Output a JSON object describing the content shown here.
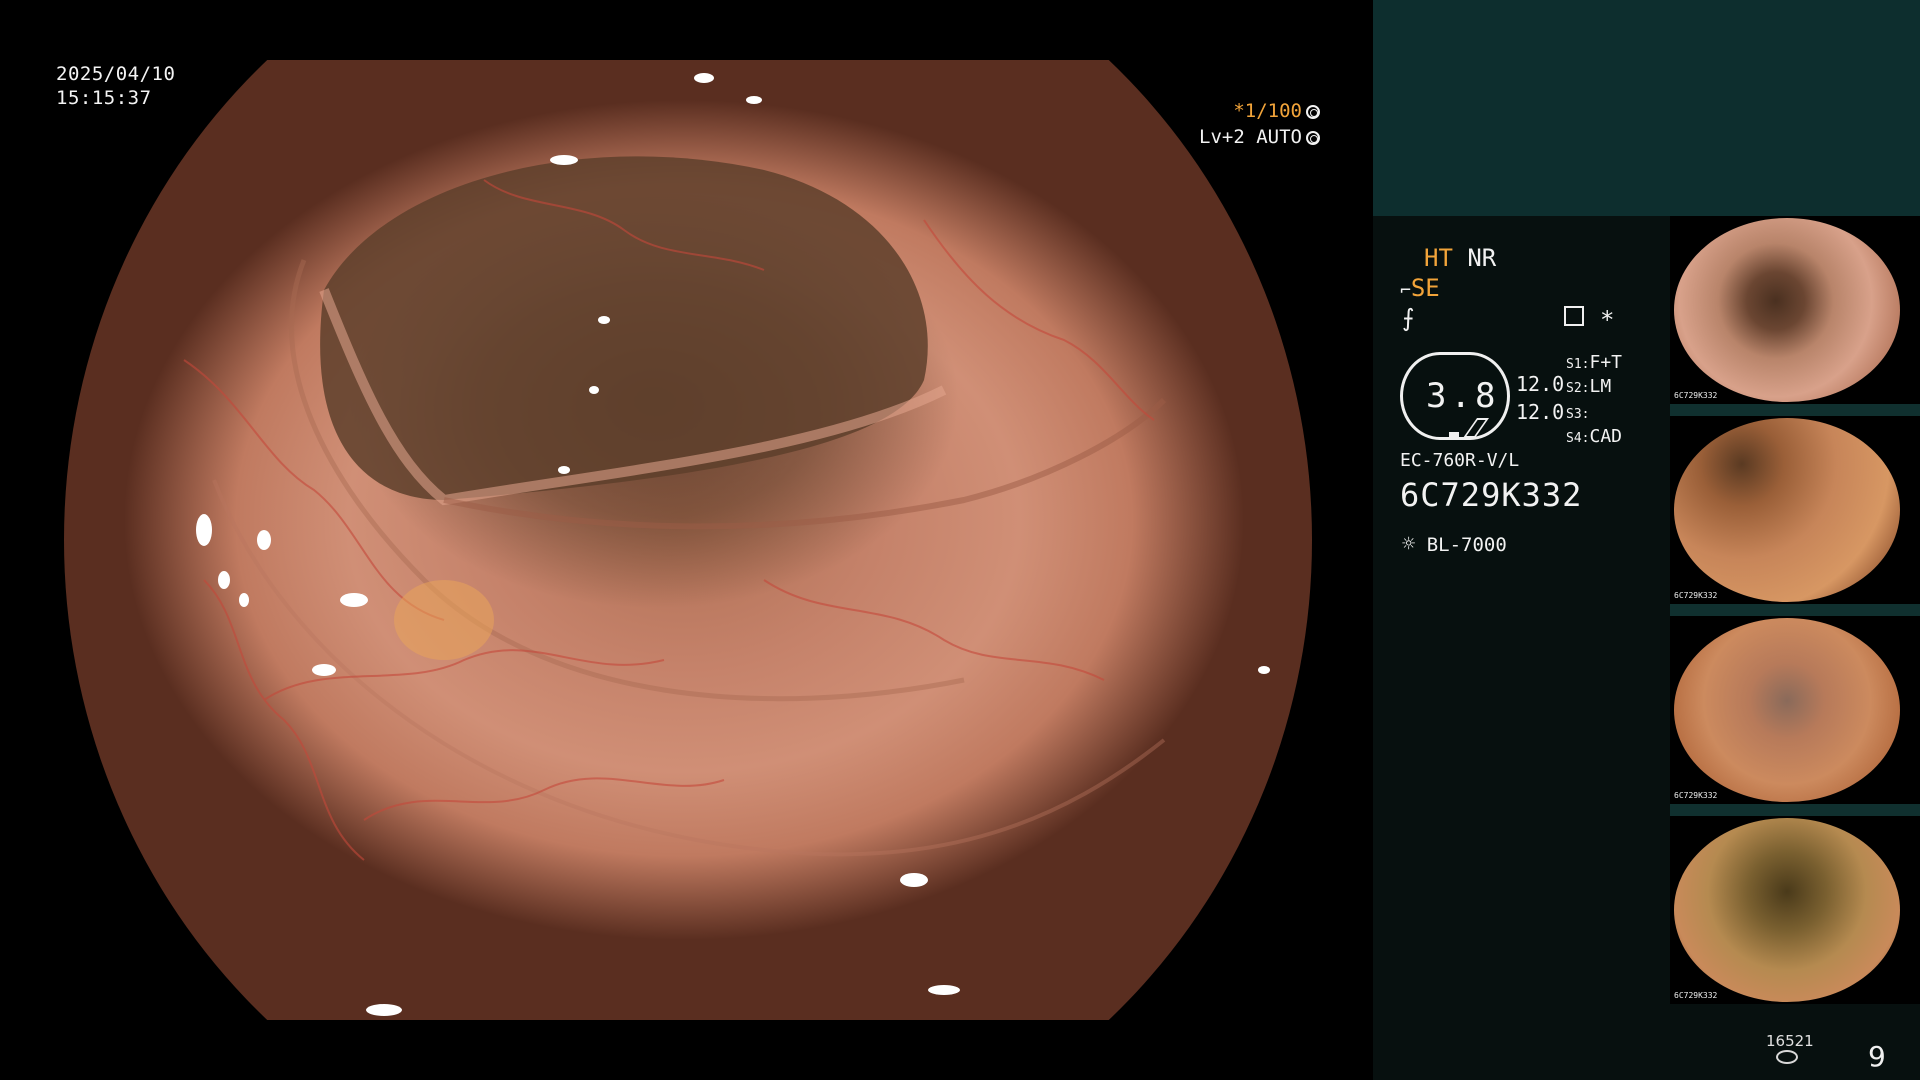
{
  "overlay": {
    "date": "2025/04/10",
    "time": "15:15:37",
    "shutter": "*1/100",
    "iris": "Lv+2 AUTO"
  },
  "panel": {
    "ht": "HT",
    "nr": "NR",
    "se": "SE",
    "scope_value": "3.8",
    "readout_1": "12.0",
    "readout_2": "12.0",
    "s1_label": "S1:",
    "s1_value": "F+T",
    "s2_label": "S2:",
    "s2_value": "LM",
    "s3_label": "S3:",
    "s3_value": "",
    "s4_label": "S4:",
    "s4_value": "CAD",
    "star": "*",
    "model": "EC-760R-V/L",
    "serial": "6C729K332",
    "light_source": "BL-7000"
  },
  "thumbnails": [
    {
      "serial": "6C729K332"
    },
    {
      "serial": "6C729K332"
    },
    {
      "serial": "6C729K332"
    },
    {
      "serial": "6C729K332"
    }
  ],
  "footer": {
    "image_count": "16521",
    "page": "9"
  },
  "colors": {
    "accent_orange": "#f2a43a",
    "panel_top": "#0d2e2e",
    "panel_bg": "#07100f"
  }
}
